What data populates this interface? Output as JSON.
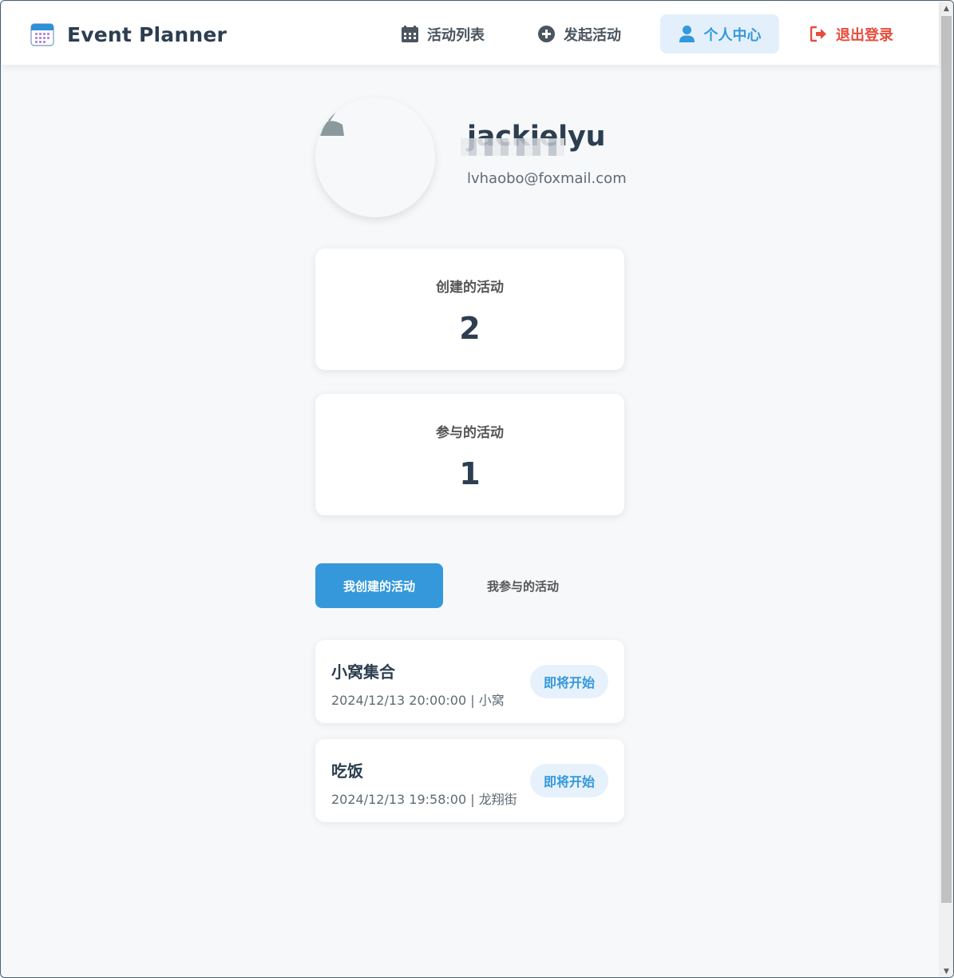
{
  "app": {
    "brand": "Event Planner"
  },
  "nav": {
    "events": "活动列表",
    "create": "发起活动",
    "profile": "个人中心",
    "logout": "退出登录"
  },
  "profile": {
    "username": "jackielyu",
    "email": "lvhaobo@foxmail.com"
  },
  "stats": {
    "created_label": "创建的活动",
    "created_count": "2",
    "joined_label": "参与的活动",
    "joined_count": "1"
  },
  "tabs": {
    "created": "我创建的活动",
    "joined": "我参与的活动"
  },
  "events": [
    {
      "title": "小窝集合",
      "meta": "2024/12/13 20:00:00 | 小窝",
      "status": "即将开始"
    },
    {
      "title": "吃饭",
      "meta": "2024/12/13 19:58:00 | 龙翔街",
      "status": "即将开始"
    }
  ],
  "colors": {
    "accent": "#3498db",
    "danger": "#e74c3c",
    "text": "#2c3e50",
    "background": "#f6f8fa"
  },
  "icons": {
    "brand": "calendar-icon",
    "events": "calendar-grid-icon",
    "create": "plus-circle-icon",
    "profile": "user-icon",
    "logout": "sign-out-icon",
    "avatar": "broken-image-icon"
  }
}
